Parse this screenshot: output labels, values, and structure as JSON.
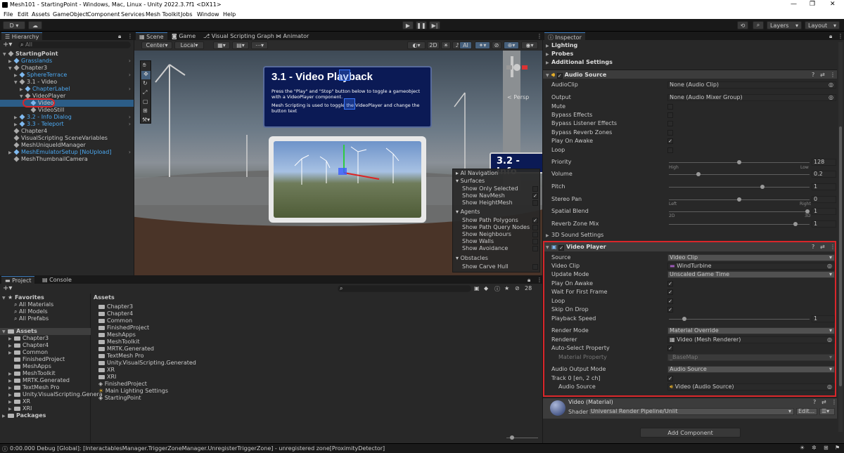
{
  "window": {
    "title": "Mesh101 - StartingPoint - Windows, Mac, Linux - Unity 2022.3.7f1 <DX11>"
  },
  "menu": [
    "File",
    "Edit",
    "Assets",
    "GameObject",
    "Component",
    "Services",
    "Mesh Toolkit",
    "Jobs",
    "Window",
    "Help"
  ],
  "toolbar": {
    "account": "D",
    "layers": "Layers",
    "layout": "Layout"
  },
  "hierarchy": {
    "tab": "Hierarchy",
    "search_placeholder": "All",
    "items": [
      {
        "label": "StartingPoint",
        "indent": 0,
        "style": "scene"
      },
      {
        "label": "Grasslands",
        "indent": 1,
        "style": "blue"
      },
      {
        "label": "Chapter3",
        "indent": 1,
        "style": "normal"
      },
      {
        "label": "SphereTerrace",
        "indent": 2,
        "style": "blue"
      },
      {
        "label": "3.1 - Video",
        "indent": 2,
        "style": "normal"
      },
      {
        "label": "ChapterLabel",
        "indent": 3,
        "style": "blue"
      },
      {
        "label": "VideoPlayer",
        "indent": 3,
        "style": "normal"
      },
      {
        "label": "Video",
        "indent": 4,
        "style": "selected"
      },
      {
        "label": "VideoStill",
        "indent": 4,
        "style": "normal"
      },
      {
        "label": "3.2 - Info Dialog",
        "indent": 2,
        "style": "blue"
      },
      {
        "label": "3.3 - Teleport",
        "indent": 2,
        "style": "blue"
      },
      {
        "label": "Chapter4",
        "indent": 1,
        "style": "normal"
      },
      {
        "label": "VisualScripting SceneVariables",
        "indent": 1,
        "style": "normal"
      },
      {
        "label": "MeshUniqueIdManager",
        "indent": 1,
        "style": "normal"
      },
      {
        "label": "MeshEmulatorSetup [NoUpload]",
        "indent": 1,
        "style": "blue"
      },
      {
        "label": "MeshThumbnailCamera",
        "indent": 1,
        "style": "normal"
      }
    ]
  },
  "scene": {
    "tabs": [
      "Scene",
      "Game",
      "Visual Scripting Graph",
      "Animator"
    ],
    "pivot": "Center",
    "space": "Local",
    "mode_2d": "2D",
    "persp": "< Persp",
    "sign1": {
      "title": "3.1 - Video Playback",
      "line1": "Press the \"Play\" and \"Stop\" button below to toggle a gameobject with a VideoPlayer component.",
      "line2": "Mesh Scripting is used to toggle the VideoPlayer and change the button text"
    },
    "sign2": {
      "title": "3.2 - Info"
    },
    "ai_nav": {
      "title": "AI Navigation",
      "surfaces": "Surfaces",
      "show_only_selected": "Show Only Selected",
      "show_navmesh": "Show NavMesh",
      "show_heightmesh": "Show HeightMesh",
      "agents": "Agents",
      "show_path_polygons": "Show Path Polygons",
      "show_path_query_nodes": "Show Path Query Nodes",
      "show_neighbours": "Show Neighbours",
      "show_walls": "Show Walls",
      "show_avoidance": "Show Avoidance",
      "obstacles": "Obstacles",
      "show_carve_hull": "Show Carve Hull"
    }
  },
  "project": {
    "tabs": [
      "Project",
      "Console"
    ],
    "count": "28",
    "favorites": "Favorites",
    "fav_items": [
      "All Materials",
      "All Models",
      "All Prefabs"
    ],
    "assets_root": "Assets",
    "tree": [
      "Chapter3",
      "Chapter4",
      "Common",
      "FinishedProject",
      "MeshApps",
      "MeshToolkit",
      "MRTK.Generated",
      "TextMesh Pro",
      "Unity.VisualScripting.Genera",
      "XR",
      "XRI"
    ],
    "packages": "Packages",
    "assets_header": "Assets",
    "assets_list": [
      {
        "label": "Chapter3",
        "kind": "folder"
      },
      {
        "label": "Chapter4",
        "kind": "folder"
      },
      {
        "label": "Common",
        "kind": "folder"
      },
      {
        "label": "FinishedProject",
        "kind": "folder"
      },
      {
        "label": "MeshApps",
        "kind": "folder"
      },
      {
        "label": "MeshToolkit",
        "kind": "folder"
      },
      {
        "label": "MRTK.Generated",
        "kind": "folder"
      },
      {
        "label": "TextMesh Pro",
        "kind": "folder"
      },
      {
        "label": "Unity.VisualScripting.Generated",
        "kind": "folder"
      },
      {
        "label": "XR",
        "kind": "folder"
      },
      {
        "label": "XRI",
        "kind": "folder"
      },
      {
        "label": "FinishedProject",
        "kind": "scene"
      },
      {
        "label": "Main Lighting Settings",
        "kind": "settings"
      },
      {
        "label": "StartingPoint",
        "kind": "scene"
      }
    ]
  },
  "inspector": {
    "tab": "Inspector",
    "lighting": "Lighting",
    "probes": "Probes",
    "additional_settings": "Additional Settings",
    "audio_source": {
      "title": "Audio Source",
      "audioclip_label": "AudioClip",
      "audioclip_value": "None (Audio Clip)",
      "output_label": "Output",
      "output_value": "None (Audio Mixer Group)",
      "mute": "Mute",
      "bypass_effects": "Bypass Effects",
      "bypass_listener": "Bypass Listener Effects",
      "bypass_reverb": "Bypass Reverb Zones",
      "play_on_awake": "Play On Awake",
      "loop": "Loop",
      "priority_label": "Priority",
      "priority_value": "128",
      "priority_fraction": 0.5,
      "high": "High",
      "low": "Low",
      "volume_label": "Volume",
      "volume_value": "0.2",
      "volume_fraction": 0.2,
      "pitch_label": "Pitch",
      "pitch_value": "1",
      "pitch_fraction": 0.67,
      "stereo_label": "Stereo Pan",
      "stereo_value": "0",
      "stereo_fraction": 0.5,
      "left": "Left",
      "right": "Right",
      "spatial_label": "Spatial Blend",
      "spatial_value": "1",
      "spatial_fraction": 1,
      "d2": "2D",
      "d3": "3D",
      "reverb_label": "Reverb Zone Mix",
      "reverb_value": "1",
      "reverb_fraction": 0.91,
      "sound3d": "3D Sound Settings"
    },
    "video_player": {
      "title": "Video Player",
      "source_label": "Source",
      "source_value": "Video Clip",
      "clip_label": "Video Clip",
      "clip_value": "WindTurbine",
      "update_label": "Update Mode",
      "update_value": "Unscaled Game Time",
      "play_on_awake": "Play On Awake",
      "wait_first_frame": "Wait For First Frame",
      "loop": "Loop",
      "skip_on_drop": "Skip On Drop",
      "speed_label": "Playback Speed",
      "speed_value": "1",
      "speed_fraction": 0.1,
      "render_label": "Render Mode",
      "render_value": "Material Override",
      "renderer_label": "Renderer",
      "renderer_value": "Video (Mesh Renderer)",
      "auto_select": "Auto-Select Property",
      "material_prop_label": "Material Property",
      "material_prop_value": "_BaseMap",
      "audio_mode_label": "Audio Output Mode",
      "audio_mode_value": "Audio Source",
      "track_label": "Track 0 [en, 2 ch]",
      "audio_source_label": "Audio Source",
      "audio_source_value": "Video (Audio Source)",
      "highlight_color": "#d9262a"
    },
    "material": {
      "title": "Video (Material)",
      "shader_label": "Shader",
      "shader_value": "Universal Render Pipeline/Unlit",
      "edit": "Edit..."
    },
    "add_component": "Add Component"
  },
  "status": {
    "text": "0:00.000 Debug [Global]: [InteractablesManager.TriggerZoneManager.UnregisterTriggerZone] - unregistered zone[ProximityDetector]"
  }
}
